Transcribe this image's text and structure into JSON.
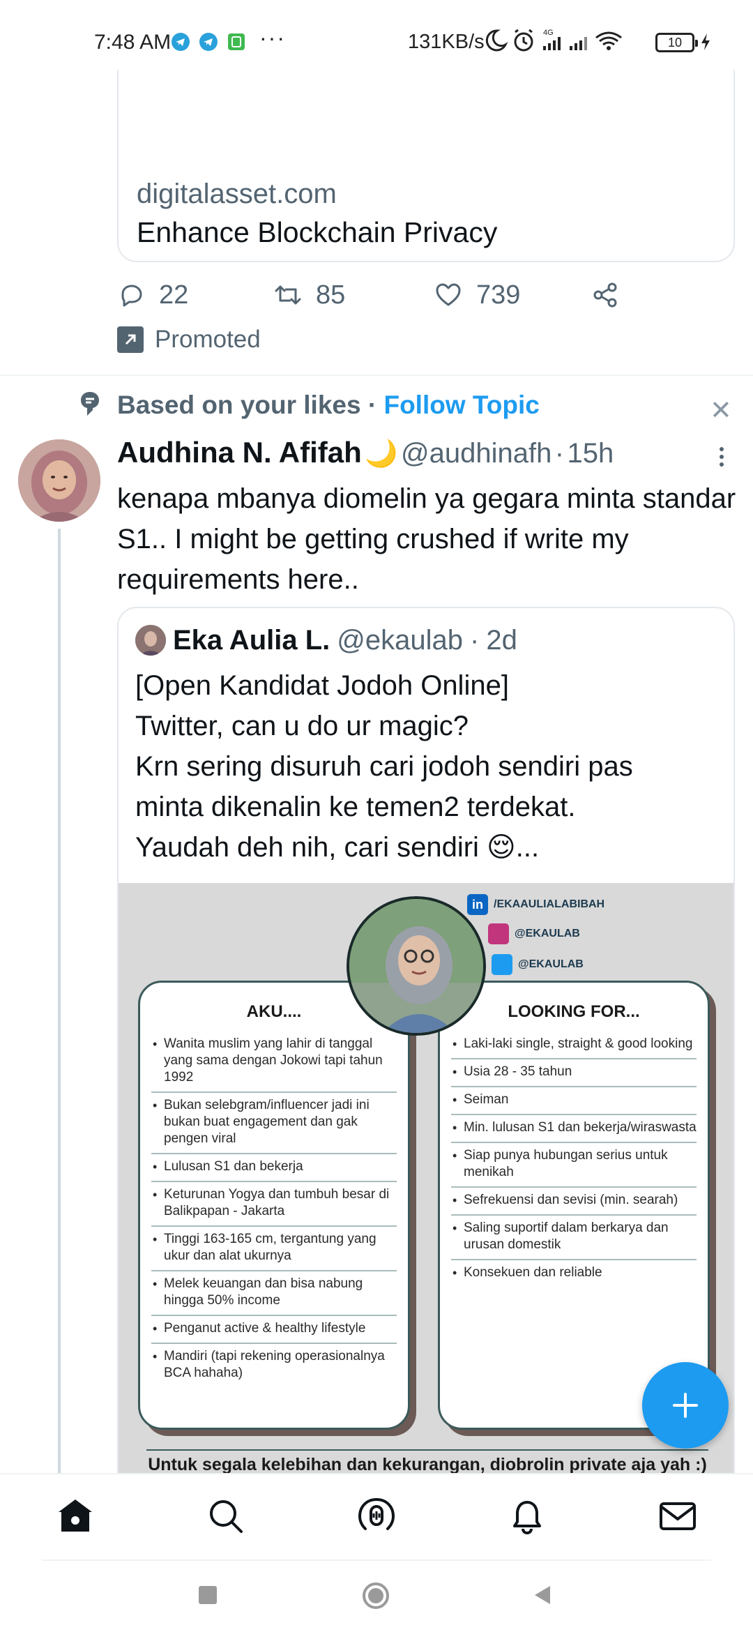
{
  "status_bar": {
    "time": "7:48 AM",
    "overflow": "···",
    "network_speed": "131KB/s",
    "network_type": "4G",
    "battery": "10",
    "icons": [
      "telegram-icon",
      "telegram-icon",
      "app-notification-icon",
      "moon-icon",
      "alarm-icon",
      "signal-icon",
      "signal-icon",
      "wifi-icon",
      "battery-icon",
      "charging-icon"
    ]
  },
  "promoted_tweet": {
    "card_domain": "digitalasset.com",
    "card_title": "Enhance Blockchain Privacy",
    "replies": "22",
    "retweets": "85",
    "likes": "739",
    "promoted_label": "Promoted"
  },
  "context": {
    "label": "Based on your likes",
    "separator": " · ",
    "follow_label": "Follow Topic"
  },
  "tweet": {
    "author_name": "Audhina N. Afifah",
    "emoji": "🌙",
    "handle": "@audhinafh",
    "time": "15h",
    "text": "kenapa mbanya diomelin ya gegara minta standar S1.. I might be getting crushed if write my requirements here.."
  },
  "quote": {
    "author_name": "Eka Aulia L.",
    "handle": "@ekaulab",
    "time": "2d",
    "lines": [
      "[Open Kandidat Jodoh Online]",
      "Twitter, can u do ur magic?",
      "Krn sering disuruh cari jodoh sendiri pas",
      "minta dikenalin ke temen2 terdekat.",
      "Yaudah deh nih, cari sendiri 😌..."
    ]
  },
  "image": {
    "social": {
      "linkedin": "/EKAAULIALABIBAH",
      "instagram": "@EKAULAB",
      "twitter": "@EKAULAB"
    },
    "left_title": "AKU....",
    "left_items": [
      "Wanita muslim yang lahir di tanggal yang sama dengan Jokowi tapi tahun 1992",
      "Bukan selebgram/influencer jadi ini bukan buat engagement dan gak pengen viral",
      "Lulusan S1 dan bekerja",
      "Keturunan Yogya dan tumbuh besar di Balikpapan - Jakarta",
      "Tinggi 163-165 cm, tergantung yang ukur dan alat ukurnya",
      "Melek keuangan dan bisa nabung hingga 50% income",
      "Penganut active & healthy lifestyle",
      "Mandiri (tapi rekening operasionalnya BCA hahaha)"
    ],
    "right_title": "LOOKING FOR...",
    "right_items": [
      "Laki-laki single, straight & good looking",
      "Usia 28 - 35 tahun",
      "Seiman",
      "Min. lulusan S1 dan bekerja/wiraswasta",
      "Siap punya hubungan serius untuk menikah",
      "Sefrekuensi dan sevisi (min. searah)",
      "Saling suportif dalam berkarya dan urusan domestik",
      "Konsekuen dan reliable"
    ],
    "footer": "Untuk segala kelebihan dan kekurangan, diobrolin private aja yah :)"
  },
  "bottom_nav": [
    "home-icon",
    "search-icon",
    "spaces-icon",
    "notifications-icon",
    "messages-icon"
  ],
  "system_nav": [
    "recents-button",
    "home-button",
    "back-button"
  ],
  "colors": {
    "accent": "#1d9bf0",
    "text": "#0f1419",
    "secondary": "#536471",
    "border": "#e4e8ec"
  }
}
